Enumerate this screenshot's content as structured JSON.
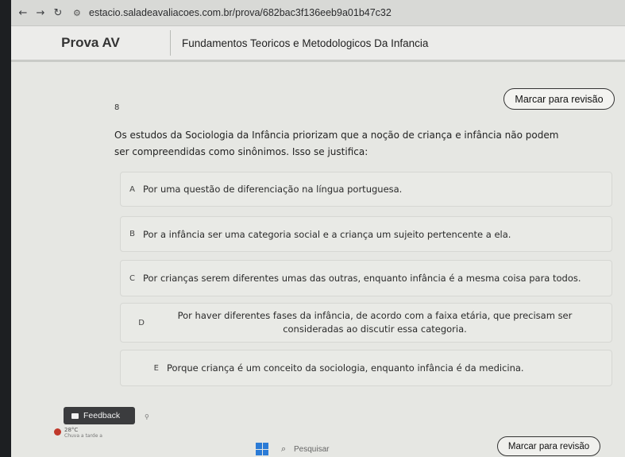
{
  "browser": {
    "url": "estacio.saladeavaliacoes.com.br/prova/682bac3f136eeb9a01b47c32",
    "icons": [
      "back-arrow",
      "forward-arrow",
      "reload",
      "site-settings"
    ]
  },
  "header": {
    "title": "Prova AV",
    "course": "Fundamentos Teoricos e Metodologicos Da Infancia"
  },
  "question": {
    "number": "8",
    "review_label": "Marcar para revisão",
    "statement": "Os estudos da Sociologia da Infância priorizam que a noção de criança e infância não podem ser compreendidas como sinônimos. Isso se justifica:",
    "options": [
      {
        "letter": "A",
        "text": "Por uma questão de diferenciação na língua portuguesa."
      },
      {
        "letter": "B",
        "text": "Por a infância ser uma categoria social e a criança um sujeito pertencente a ela."
      },
      {
        "letter": "C",
        "text": "Por crianças serem diferentes umas das outras, enquanto infância é a mesma coisa para todos."
      },
      {
        "letter": "D",
        "text": "Por haver diferentes fases da infância, de acordo com a faixa etária, que precisam ser consideradas ao discutir essa categoria."
      },
      {
        "letter": "E",
        "text": "Porque criança é um conceito da sociologia, enquanto infância é da medicina."
      }
    ]
  },
  "feedback": {
    "label": "Feedback"
  },
  "taskbar": {
    "weather_temp": "28°C",
    "weather_desc": "Chuva a tarde a",
    "search_label": "Pesquisar",
    "review_label": "Marcar para revisão"
  }
}
